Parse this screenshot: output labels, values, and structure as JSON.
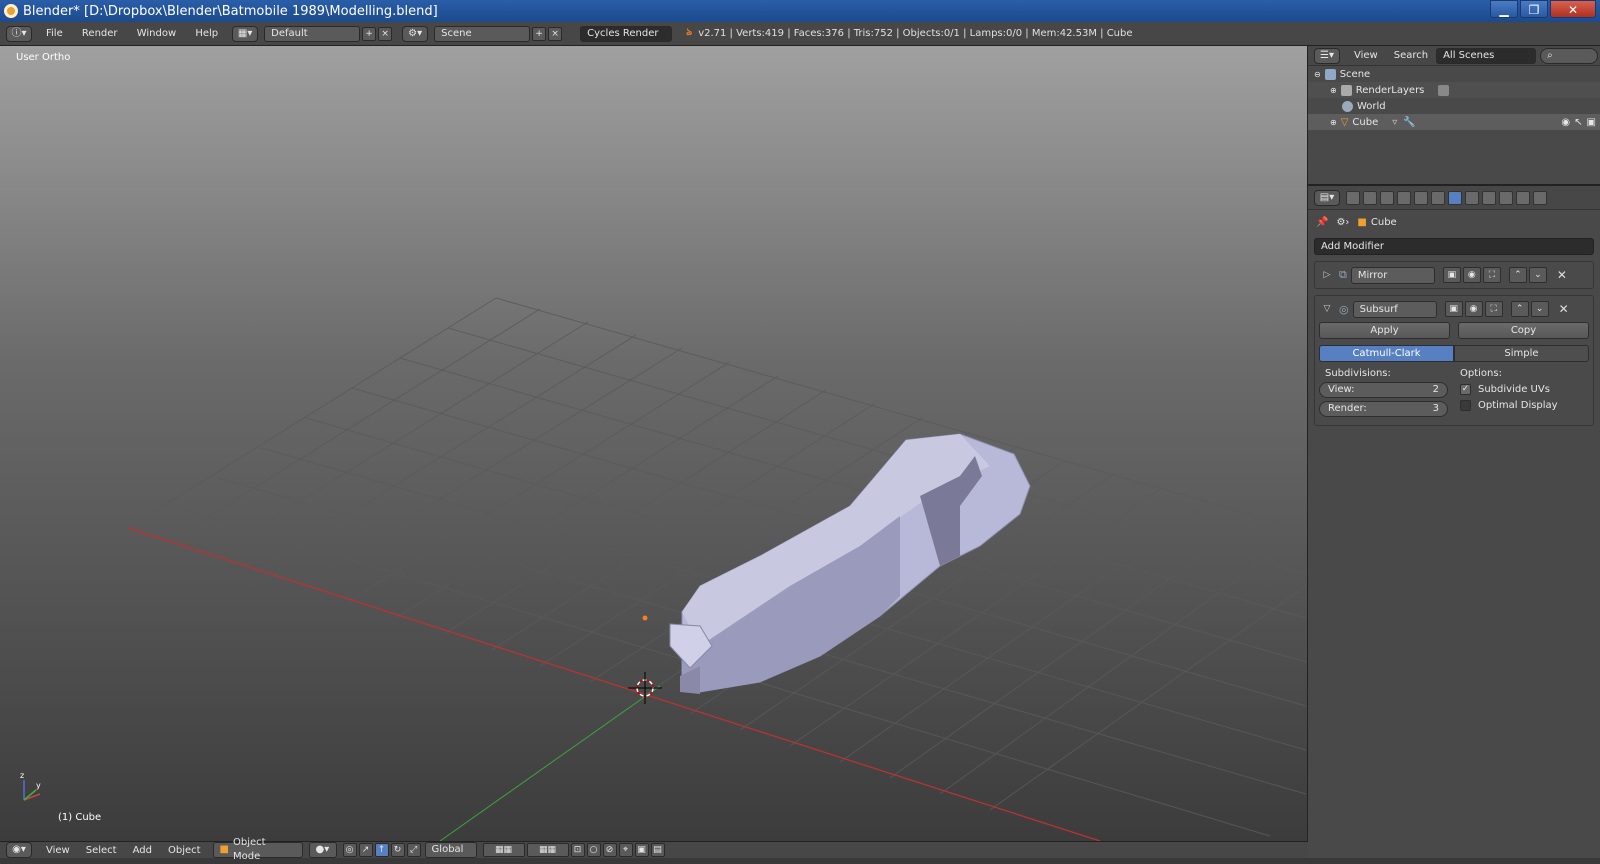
{
  "window": {
    "title": "Blender* [D:\\Dropbox\\Blender\\Batmobile 1989\\Modelling.blend]",
    "buttons": {
      "minimize": "▁",
      "maximize": "❐",
      "close": "✕"
    }
  },
  "topbar": {
    "menus": [
      "File",
      "Render",
      "Window",
      "Help"
    ],
    "layout": "Default",
    "scene": "Scene",
    "engine": "Cycles Render",
    "stats": "v2.71 | Verts:419 | Faces:376 | Tris:752 | Objects:0/1 | Lamps:0/0 | Mem:42.53M | Cube"
  },
  "viewport": {
    "view_label": "User Ortho",
    "object_label": "(1) Cube"
  },
  "viewport_footer": {
    "menus": [
      "View",
      "Select",
      "Add",
      "Object"
    ],
    "mode": "Object Mode",
    "orientation": "Global"
  },
  "outliner": {
    "menus": [
      "View",
      "Search"
    ],
    "filter": "All Scenes",
    "items": [
      {
        "label": "Scene",
        "level": 0
      },
      {
        "label": "RenderLayers",
        "level": 1
      },
      {
        "label": "World",
        "level": 1
      },
      {
        "label": "Cube",
        "level": 1
      }
    ]
  },
  "properties": {
    "context_object": "Cube",
    "add_modifier": "Add Modifier",
    "modifiers": [
      {
        "name": "Mirror",
        "collapsed": true
      },
      {
        "name": "Subsurf",
        "collapsed": false
      }
    ],
    "apply_label": "Apply",
    "copy_label": "Copy",
    "algo_on": "Catmull-Clark",
    "algo_off": "Simple",
    "subdivisions_label": "Subdivisions:",
    "options_label": "Options:",
    "view_label": "View:",
    "view_value": "2",
    "render_label": "Render:",
    "render_value": "3",
    "subdivide_uvs": "Subdivide UVs",
    "optimal_display": "Optimal Display"
  },
  "colors": {
    "accent": "#5680c2",
    "x_axis": "#c03030",
    "y_axis": "#40a040",
    "mesh": "#b8b8d8"
  }
}
